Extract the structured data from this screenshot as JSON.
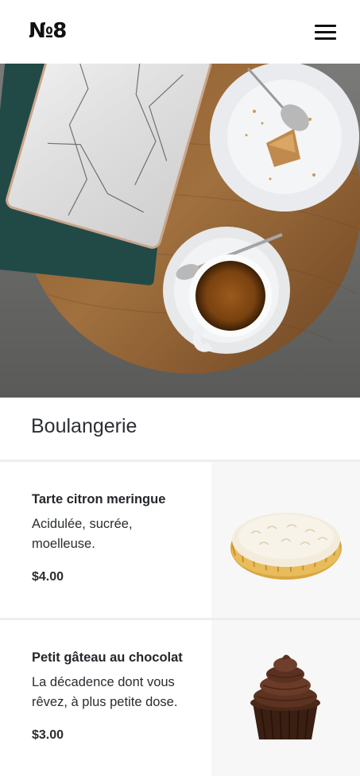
{
  "header": {
    "logo": "№8",
    "menu_icon": "hamburger-menu-icon"
  },
  "section": {
    "title": "Boulangerie"
  },
  "products": [
    {
      "name": "Tarte citron meringue",
      "description_line1": "Acidulée, sucrée,",
      "description_line2": "moelleuse.",
      "price": "$4.00",
      "image": "lemon-meringue-tart"
    },
    {
      "name": "Petit gâteau au chocolat",
      "description_line1": "La décadence dont vous",
      "description_line2": "rêvez, à plus petite dose.",
      "price": "$3.00",
      "image": "chocolate-cupcake"
    }
  ],
  "colors": {
    "background": "#ffffff",
    "text": "#24272b",
    "image_panel": "#f7f7f7",
    "divider": "#eeeeee"
  }
}
